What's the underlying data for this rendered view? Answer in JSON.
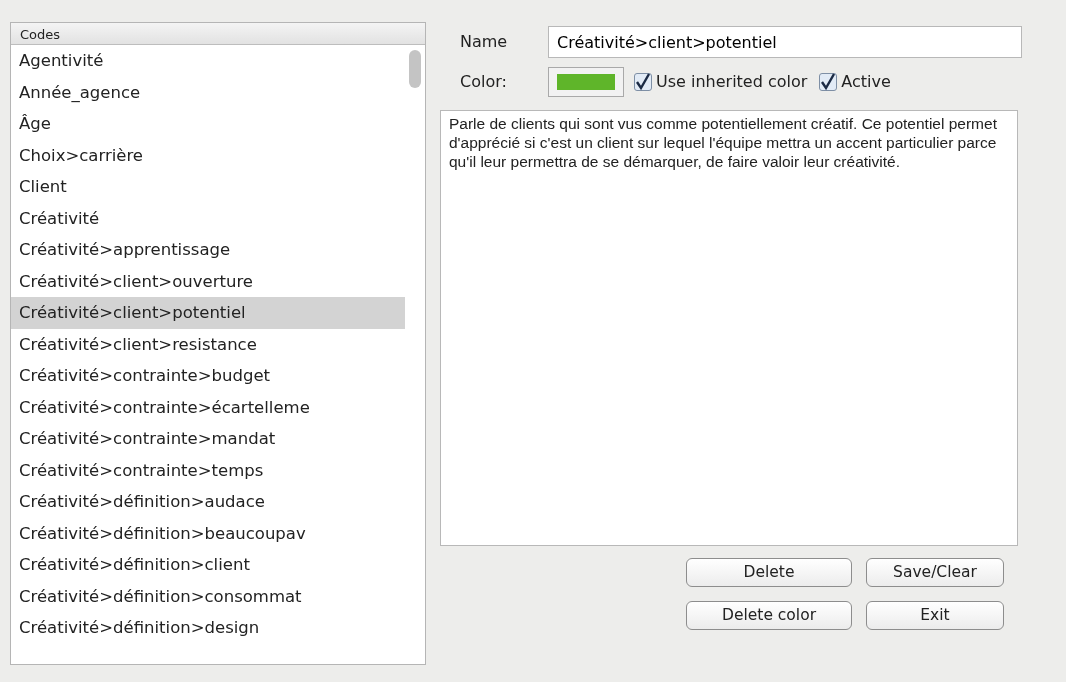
{
  "codes_list": {
    "header": "Codes",
    "items": [
      {
        "label": "Agentivité",
        "selected": false
      },
      {
        "label": "Année_agence",
        "selected": false
      },
      {
        "label": "Âge",
        "selected": false
      },
      {
        "label": "Choix>carrière",
        "selected": false
      },
      {
        "label": "Client",
        "selected": false
      },
      {
        "label": "Créativité",
        "selected": false
      },
      {
        "label": "Créativité>apprentissage",
        "selected": false
      },
      {
        "label": "Créativité>client>ouverture",
        "selected": false
      },
      {
        "label": "Créativité>client>potentiel",
        "selected": true
      },
      {
        "label": "Créativité>client>resistance",
        "selected": false
      },
      {
        "label": "Créativité>contrainte>budget",
        "selected": false
      },
      {
        "label": "Créativité>contrainte>écartelleme",
        "selected": false
      },
      {
        "label": "Créativité>contrainte>mandat",
        "selected": false
      },
      {
        "label": "Créativité>contrainte>temps",
        "selected": false
      },
      {
        "label": "Créativité>définition>audace",
        "selected": false
      },
      {
        "label": "Créativité>définition>beaucoupav",
        "selected": false
      },
      {
        "label": "Créativité>définition>client",
        "selected": false
      },
      {
        "label": "Créativité>définition>consommat",
        "selected": false
      },
      {
        "label": "Créativité>définition>design",
        "selected": false
      }
    ]
  },
  "name_field": {
    "label": "Name",
    "value": "Créativité>client>potentiel"
  },
  "color_field": {
    "label": "Color:",
    "color": "#5fb52a"
  },
  "checkboxes": [
    {
      "label": "Use inherited color",
      "checked": true
    },
    {
      "label": "Active",
      "checked": true
    }
  ],
  "description": "Parle de clients qui sont vus comme potentiellement créatif. Ce potentiel permet d'apprécié si c'est un client sur lequel l'équipe mettra un accent particulier parce qu'il leur permettra de se démarquer, de faire valoir leur créativité.",
  "buttons": [
    [
      "Delete",
      "Save/Clear"
    ],
    [
      "Delete color",
      "Exit"
    ]
  ]
}
